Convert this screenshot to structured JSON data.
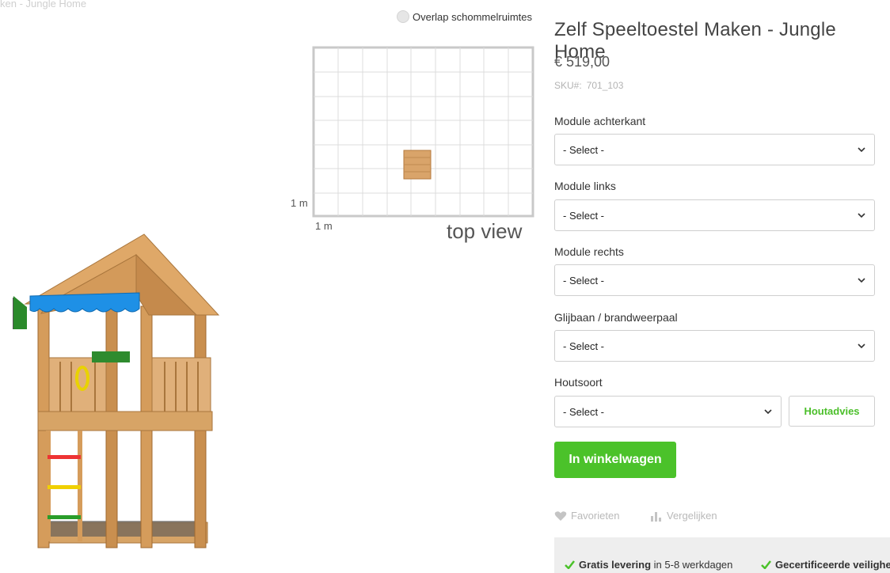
{
  "breadcrumb": "ken - Jungle Home",
  "top_view": {
    "overlap_label": "Overlap schommelruimtes",
    "scale_y": "1 m",
    "scale_x": "1 m",
    "caption": "top view"
  },
  "product": {
    "title": "Zelf Speeltoestel Maken - Jungle Home",
    "price": "€ 519,00",
    "sku_label": "SKU#:",
    "sku_value": "701_103"
  },
  "options": [
    {
      "label": "Module achterkant",
      "value": "- Select -"
    },
    {
      "label": "Module links",
      "value": "- Select -"
    },
    {
      "label": "Module rechts",
      "value": "- Select -"
    },
    {
      "label": "Glijbaan / brandweerpaal",
      "value": "- Select -"
    },
    {
      "label": "Houtsoort",
      "value": "- Select -"
    }
  ],
  "buttons": {
    "wood_advice": "Houtadvies",
    "add_to_cart": "In winkelwagen",
    "favorites": "Favorieten",
    "compare": "Vergelijken"
  },
  "usps": [
    {
      "bold": "Gratis levering",
      "rest": " in 5-8 werkdagen"
    },
    {
      "bold": "Gecertificeerde veiligheid",
      "rest": ""
    }
  ],
  "colors": {
    "accent_green": "#4bc22a",
    "usp_background": "#eeeeee"
  },
  "icons": {
    "select": "chevron-down-icon",
    "favorites": "heart-icon",
    "compare": "bar-chart-icon",
    "usp": "check-icon"
  }
}
